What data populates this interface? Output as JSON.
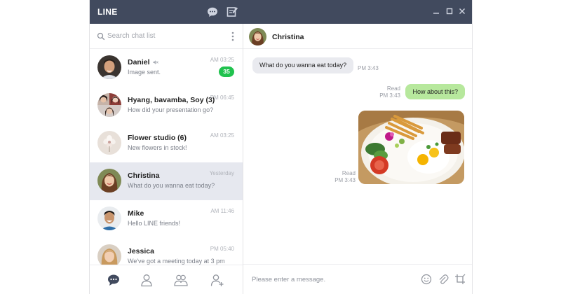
{
  "app": {
    "logo": "LINE"
  },
  "titlebar": {
    "icons": [
      "chat-bubble-icon",
      "compose-note-icon"
    ],
    "window_controls": [
      "minimize-icon",
      "maximize-icon",
      "close-icon"
    ]
  },
  "search": {
    "placeholder": "Search chat list"
  },
  "chats": [
    {
      "name": "Daniel",
      "preview": "Image sent.",
      "time": "AM 03:25",
      "unread": "35",
      "muted": true
    },
    {
      "name": "Hyang, bavamba, Soy (3)",
      "preview": "How did your presentation go?",
      "time": "PM 06:45"
    },
    {
      "name": "Flower studio (6)",
      "preview": "New flowers in stock!",
      "time": "AM 03:25"
    },
    {
      "name": "Christina",
      "preview": "What do you wanna eat today?",
      "time": "Yesterday",
      "selected": true
    },
    {
      "name": "Mike",
      "preview": "Hello LINE friends!",
      "time": "AM 11:46"
    },
    {
      "name": "Jessica",
      "preview": "We've got a meeting today at 3 pm",
      "time": "PM 05:40"
    }
  ],
  "bottom_nav": [
    "chats-icon",
    "friends-icon",
    "groups-icon",
    "add-friend-icon"
  ],
  "conversation": {
    "title": "Christina",
    "messages": [
      {
        "dir": "in",
        "text": "What do you wanna eat today?",
        "time": "PM 3:43"
      },
      {
        "dir": "out",
        "text": "How about this?",
        "status": "Read",
        "time": "PM 3:43"
      },
      {
        "dir": "out",
        "type": "image",
        "status": "Read",
        "time": "PM 3:43"
      }
    ]
  },
  "composer": {
    "placeholder": "Please enter a message.",
    "icons": [
      "emoji-icon",
      "attachment-icon",
      "screenshot-crop-icon"
    ]
  },
  "colors": {
    "titlebar": "#414a5e",
    "unread_badge": "#20c24e",
    "outgoing_bubble": "#b7e89d",
    "incoming_bubble": "#e9eaef",
    "selected_row": "#e6e8ef"
  }
}
